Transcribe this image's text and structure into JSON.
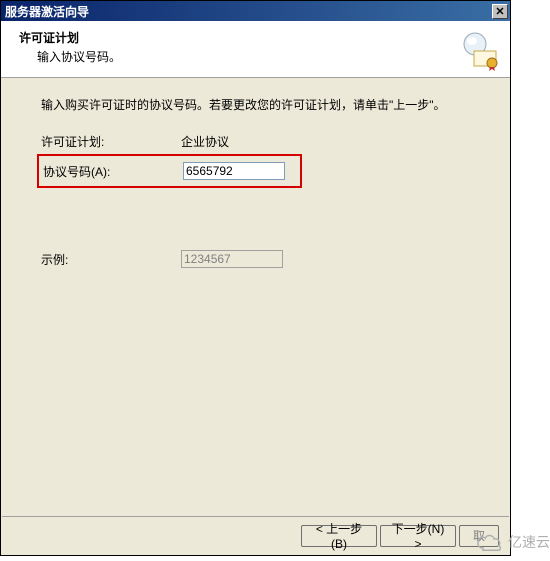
{
  "window": {
    "title": "服务器激活向导",
    "close_glyph": "✕"
  },
  "header": {
    "title": "许可证计划",
    "subtitle": "输入协议号码。"
  },
  "content": {
    "instruction": "输入购买许可证时的协议号码。若要更改您的许可证计划，请单击\"上一步\"。",
    "plan_label": "许可证计划:",
    "plan_value": "企业协议",
    "agreement_label": "协议号码(A):",
    "agreement_value": "6565792",
    "example_label": "示例:",
    "example_value": "1234567"
  },
  "buttons": {
    "back": "< 上一步(B)",
    "next": "下一步(N) >",
    "cancel_partial": "取"
  },
  "watermark": "亿速云"
}
